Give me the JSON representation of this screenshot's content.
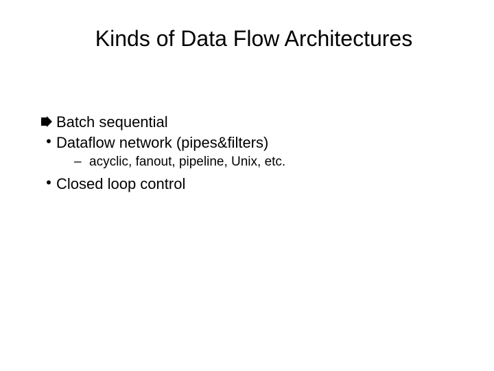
{
  "title": "Kinds of Data Flow Architectures",
  "bullets": {
    "item0": {
      "text": "Batch sequential"
    },
    "item1": {
      "text": "Dataflow network (pipes&filters)",
      "sub": "acyclic, fanout, pipeline, Unix, etc."
    },
    "item2": {
      "text": "Closed loop control"
    }
  }
}
